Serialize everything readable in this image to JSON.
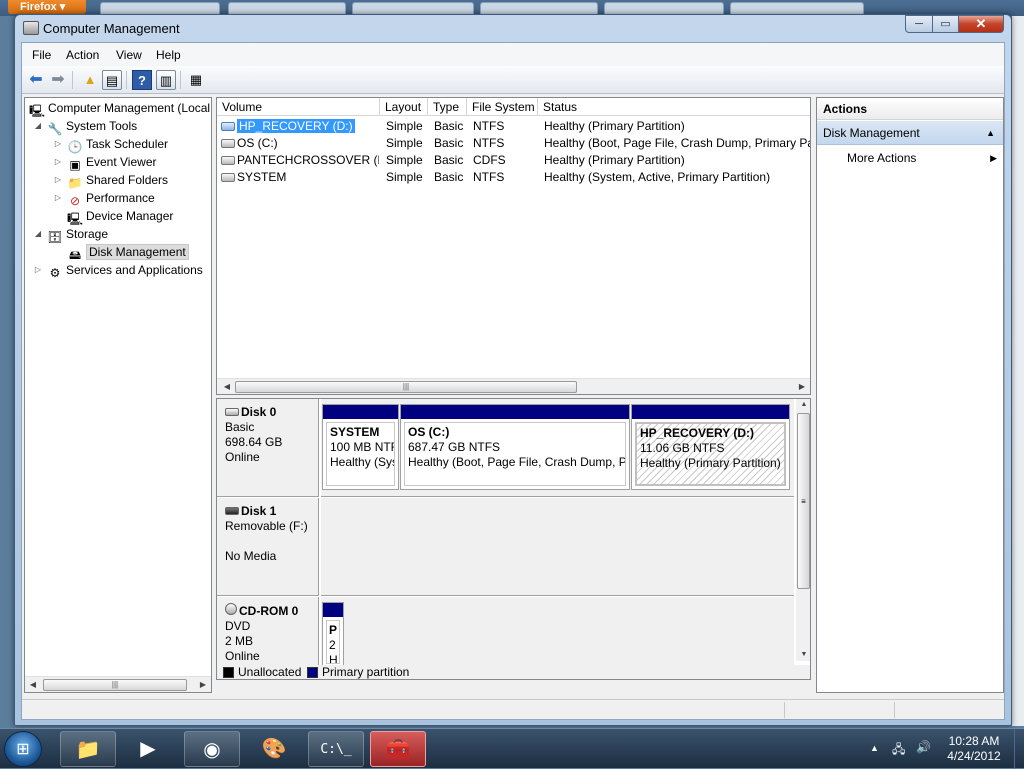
{
  "background": {
    "firefox_label": "Firefox"
  },
  "window": {
    "title": "Computer Management",
    "controls": {
      "minimize": "─",
      "maximize": "▭",
      "close": "✕"
    }
  },
  "menu": [
    "File",
    "Action",
    "View",
    "Help"
  ],
  "toolbar_icons": [
    "back-arrow-icon",
    "forward-arrow-icon",
    "up-folder-icon",
    "show-hide-tree-icon",
    "help-icon",
    "show-hide-action-pane-icon",
    "properties-icon"
  ],
  "tree": {
    "root": "Computer Management (Local",
    "system_tools": "System Tools",
    "task_scheduler": "Task Scheduler",
    "event_viewer": "Event Viewer",
    "shared_folders": "Shared Folders",
    "performance": "Performance",
    "device_manager": "Device Manager",
    "storage": "Storage",
    "disk_management": "Disk Management",
    "services": "Services and Applications"
  },
  "volume_list": {
    "columns": [
      "Volume",
      "Layout",
      "Type",
      "File System",
      "Status"
    ],
    "rows": [
      {
        "volume": "HP_RECOVERY (D:)",
        "layout": "Simple",
        "type": "Basic",
        "fs": "NTFS",
        "status": "Healthy (Primary Partition)"
      },
      {
        "volume": "OS (C:)",
        "layout": "Simple",
        "type": "Basic",
        "fs": "NTFS",
        "status": "Healthy (Boot, Page File, Crash Dump, Primary Part"
      },
      {
        "volume": "PANTECHCROSSOVER (E:)",
        "layout": "Simple",
        "type": "Basic",
        "fs": "CDFS",
        "status": "Healthy (Primary Partition)"
      },
      {
        "volume": "SYSTEM",
        "layout": "Simple",
        "type": "Basic",
        "fs": "NTFS",
        "status": "Healthy (System, Active, Primary Partition)"
      }
    ]
  },
  "disks": {
    "disk0": {
      "name": "Disk 0",
      "type": "Basic",
      "size": "698.64 GB",
      "state": "Online",
      "partitions": [
        {
          "name": "SYSTEM",
          "size": "100 MB NTF",
          "status": "Healthy (Sys"
        },
        {
          "name": "OS  (C:)",
          "size": "687.47 GB NTFS",
          "status": "Healthy (Boot, Page File, Crash Dump, Pr"
        },
        {
          "name": "HP_RECOVERY  (D:)",
          "size": "11.06 GB NTFS",
          "status": "Healthy (Primary Partition)"
        }
      ]
    },
    "disk1": {
      "name": "Disk 1",
      "type": "Removable (F:)",
      "media": "No Media"
    },
    "cdrom0": {
      "name": "CD-ROM 0",
      "type": "DVD",
      "size": "2 MB",
      "state": "Online",
      "partition": {
        "l1": "P",
        "l2": "2",
        "l3": "H"
      }
    }
  },
  "legend": [
    {
      "label": "Unallocated",
      "color": "#000000"
    },
    {
      "label": "Primary partition",
      "color": "#000080"
    }
  ],
  "actions": {
    "header": "Actions",
    "section": "Disk Management",
    "item": "More Actions"
  },
  "taskbar": {
    "apps": [
      "explorer-icon",
      "media-player-icon",
      "firefox-icon",
      "paint-icon",
      "cmd-icon",
      "computer-management-icon"
    ],
    "clock_time": "10:28 AM",
    "clock_date": "4/24/2012"
  }
}
